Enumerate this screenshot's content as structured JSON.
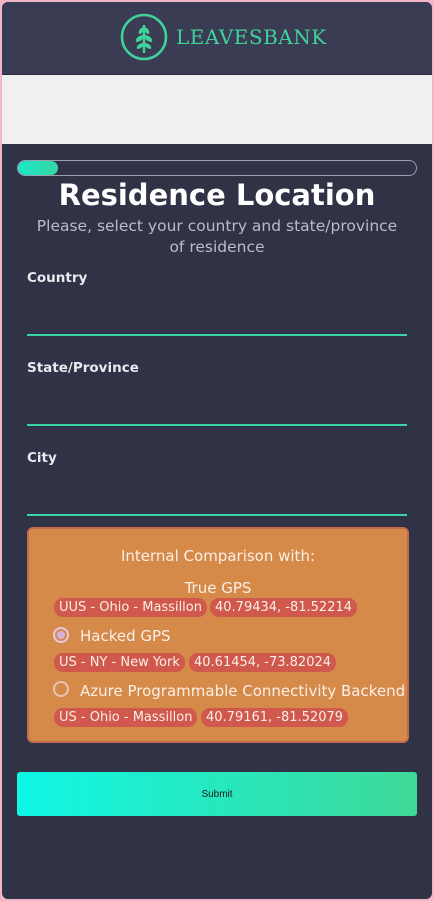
{
  "brand": {
    "name": "LEAVESBANK",
    "icon": "leaf-tree-icon",
    "color": "#3fd39b"
  },
  "progress": {
    "fraction": 0.1
  },
  "page": {
    "title": "Residence Location",
    "subtitle": "Please, select your country and state/province of residence"
  },
  "fields": {
    "country_label": "Country",
    "country_value": "",
    "state_label": "State/Province",
    "state_value": "",
    "city_label": "City",
    "city_value": ""
  },
  "comparison": {
    "title": "Internal Comparison with:",
    "options": [
      {
        "label": "True GPS",
        "location": "UUS - Ohio - Massillon",
        "coords": "40.79434, -81.52214",
        "has_radio": false
      },
      {
        "label": "Hacked GPS",
        "location": "US - NY - New York",
        "coords": "40.61454, -73.82024",
        "has_radio": true,
        "checked": true
      },
      {
        "label": "Azure Programmable Connectivity Backend",
        "location": "US - Ohio - Massillon",
        "coords": "40.79161, -81.52079",
        "has_radio": true,
        "checked": false
      }
    ]
  },
  "submit": {
    "label": "Submit"
  }
}
